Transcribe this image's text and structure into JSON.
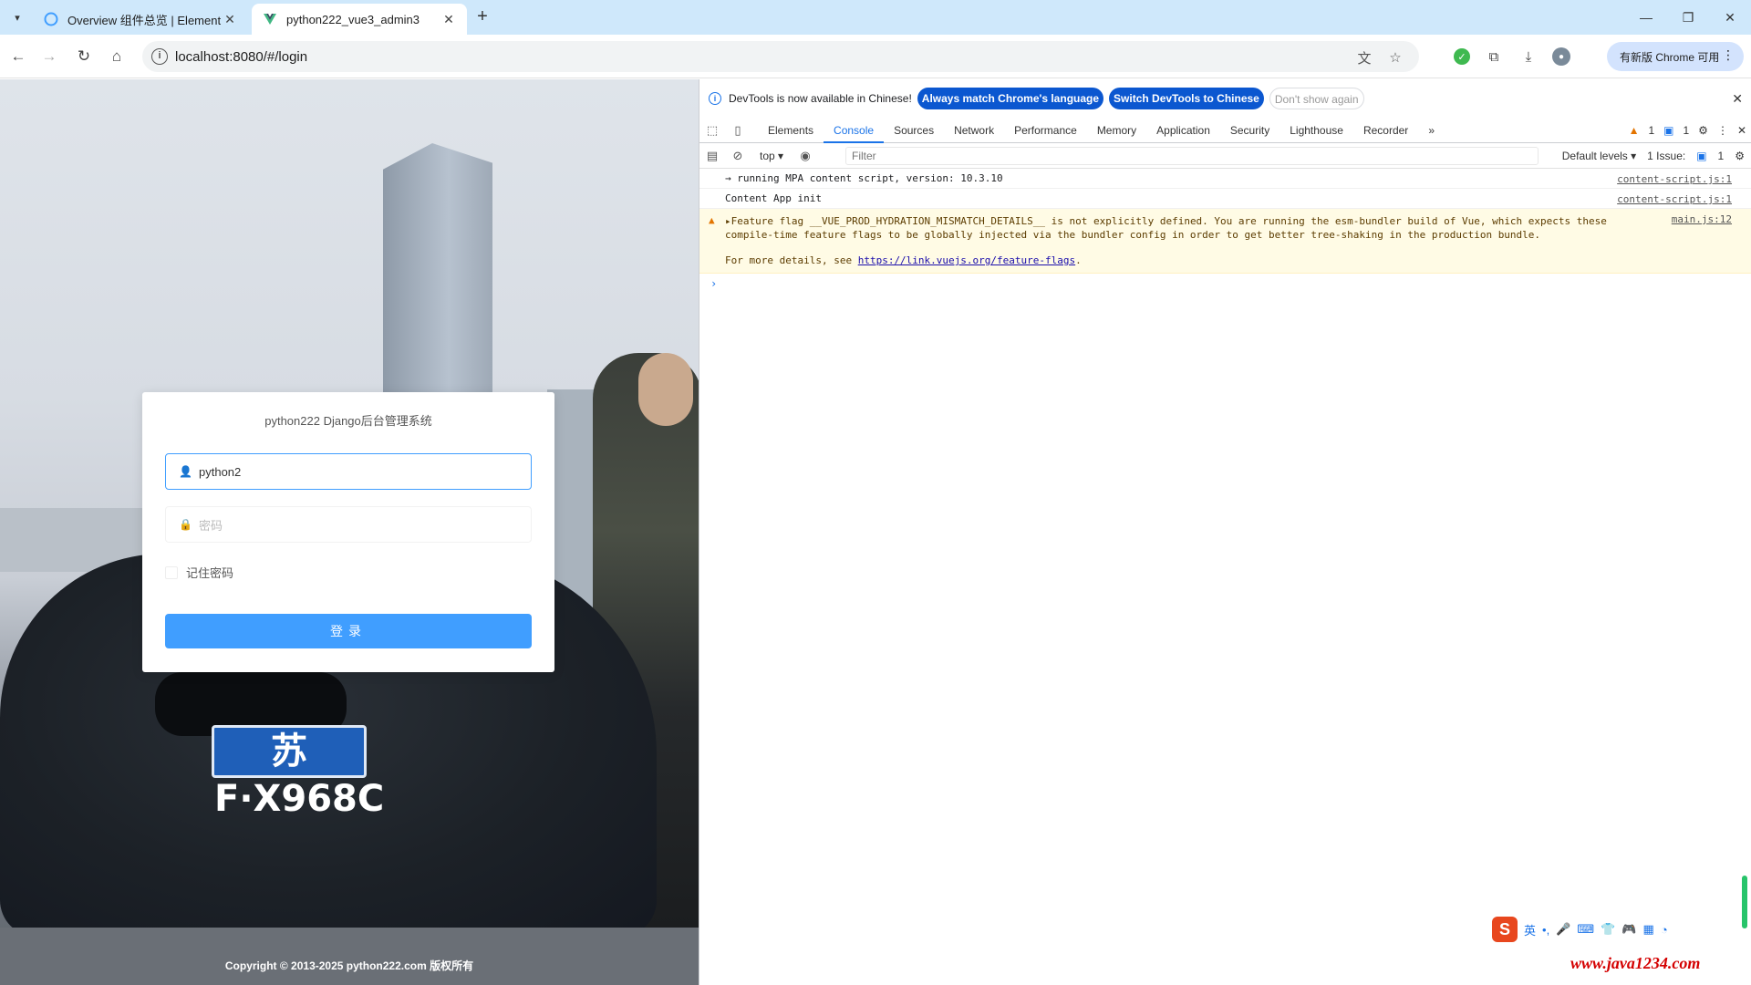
{
  "browser": {
    "tabs": [
      {
        "title": "Overview 组件总览 | Element",
        "active": false
      },
      {
        "title": "python222_vue3_admin3",
        "active": true
      }
    ],
    "url": "localhost:8080/#/login",
    "update_label": "有新版 Chrome 可用"
  },
  "login": {
    "title": "python222 Django后台管理系统",
    "username_value": "python2",
    "password_placeholder": "密码",
    "remember_label": "记住密码",
    "button_label": "登录",
    "copyright": "Copyright © 2013-2025 python222.com 版权所有"
  },
  "background": {
    "plate_text": "苏F·X968C"
  },
  "devtools": {
    "banner": {
      "message": "DevTools is now available in Chinese!",
      "btn_match": "Always match Chrome's language",
      "btn_switch": "Switch DevTools to Chinese",
      "btn_dismiss": "Don't show again"
    },
    "tabs": [
      "Elements",
      "Console",
      "Sources",
      "Network",
      "Performance",
      "Memory",
      "Application",
      "Security",
      "Lighthouse",
      "Recorder"
    ],
    "active_tab": "Console",
    "warning_count": "1",
    "message_count": "1",
    "context": "top",
    "filter_placeholder": "Filter",
    "levels": "Default levels",
    "issues": "1 Issue:",
    "issues_count": "1",
    "console": [
      {
        "text": "running MPA content script, version: 10.3.10",
        "source": "content-script.js:1"
      },
      {
        "text": "Content App init",
        "source": "content-script.js:1"
      }
    ],
    "warning": {
      "text": "Feature flag __VUE_PROD_HYDRATION_MISMATCH_DETAILS__ is not explicitly defined. You are running the esm-bundler build of Vue, which expects these compile-time feature flags to be globally injected via the bundler config in order to get better tree-shaking in the production bundle.",
      "more_prefix": "For more details, see",
      "link": "https://link.vuejs.org/feature-flags",
      "source": "main.js:12"
    }
  },
  "overlay": {
    "ime_label": "英",
    "watermark": "www.java1234.com"
  }
}
